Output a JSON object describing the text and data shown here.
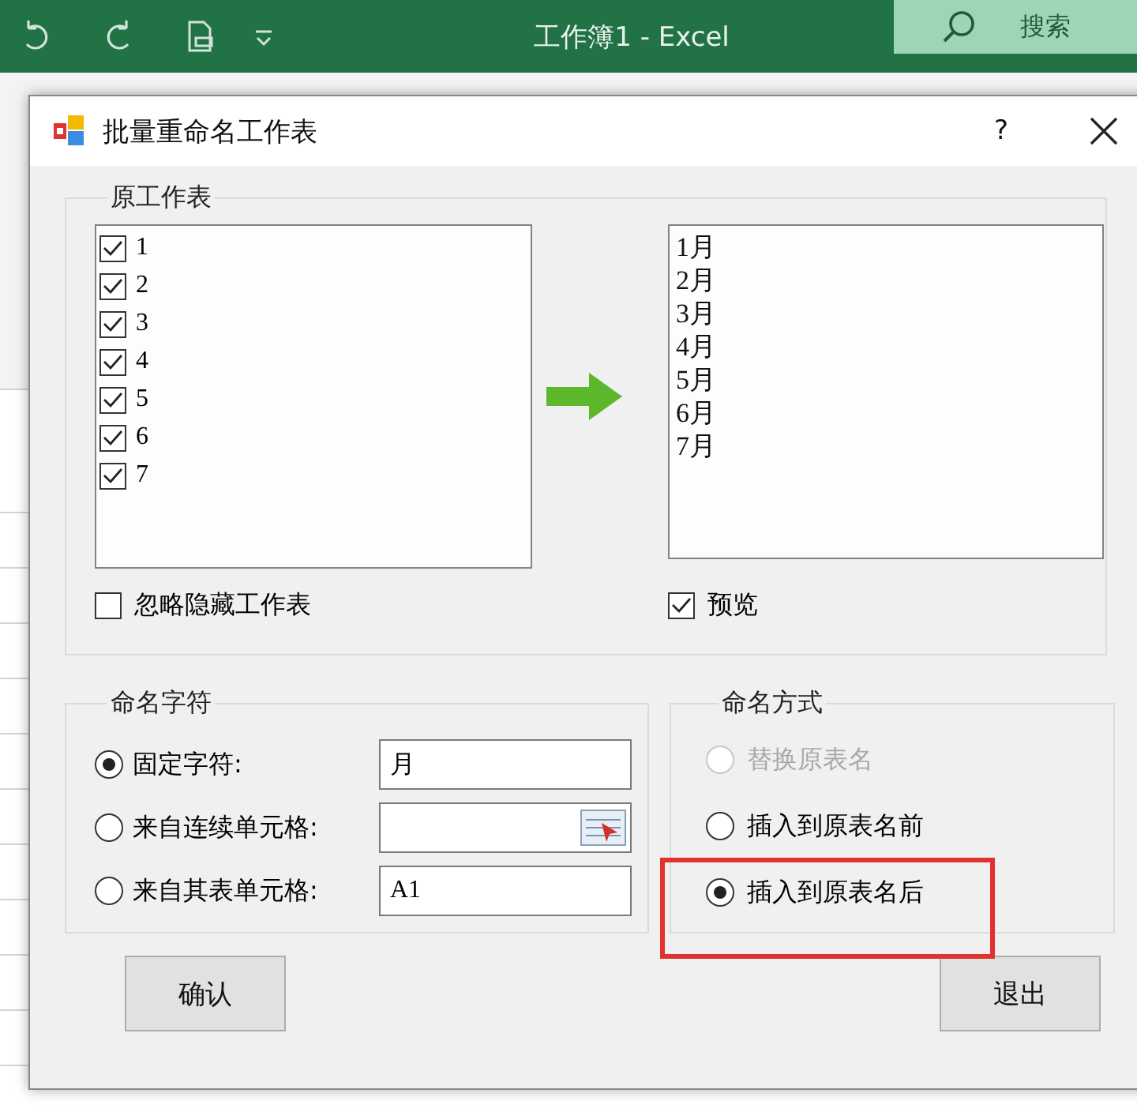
{
  "excel": {
    "title": "工作簿1  -  Excel",
    "search": "搜索"
  },
  "dialog": {
    "title": "批量重命名工作表",
    "help": "?",
    "source": {
      "label": "原工作表",
      "sheets": [
        {
          "name": "1",
          "checked": true
        },
        {
          "name": "2",
          "checked": true
        },
        {
          "name": "3",
          "checked": true
        },
        {
          "name": "4",
          "checked": true
        },
        {
          "name": "5",
          "checked": true
        },
        {
          "name": "6",
          "checked": true
        },
        {
          "name": "7",
          "checked": true
        }
      ],
      "ignore_hidden": {
        "label": "忽略隐藏工作表",
        "checked": false
      }
    },
    "preview": {
      "items": [
        "1月",
        "2月",
        "3月",
        "4月",
        "5月",
        "6月",
        "7月"
      ],
      "option": {
        "label": "预览",
        "checked": true
      }
    },
    "naming_chars": {
      "label": "命名字符",
      "options": [
        {
          "label": "固定字符:",
          "selected": true,
          "kind": "text",
          "value": "月"
        },
        {
          "label": "来自连续单元格:",
          "selected": false,
          "kind": "picker"
        },
        {
          "label": "来自其表单元格:",
          "selected": false,
          "kind": "text",
          "value": "A1"
        }
      ]
    },
    "naming_mode": {
      "label": "命名方式",
      "options": [
        {
          "label": "替换原表名",
          "selected": false,
          "disabled": true
        },
        {
          "label": "插入到原表名前",
          "selected": false,
          "disabled": false
        },
        {
          "label": "插入到原表名后",
          "selected": true,
          "disabled": false
        }
      ]
    },
    "buttons": [
      "确认",
      "退出"
    ]
  }
}
